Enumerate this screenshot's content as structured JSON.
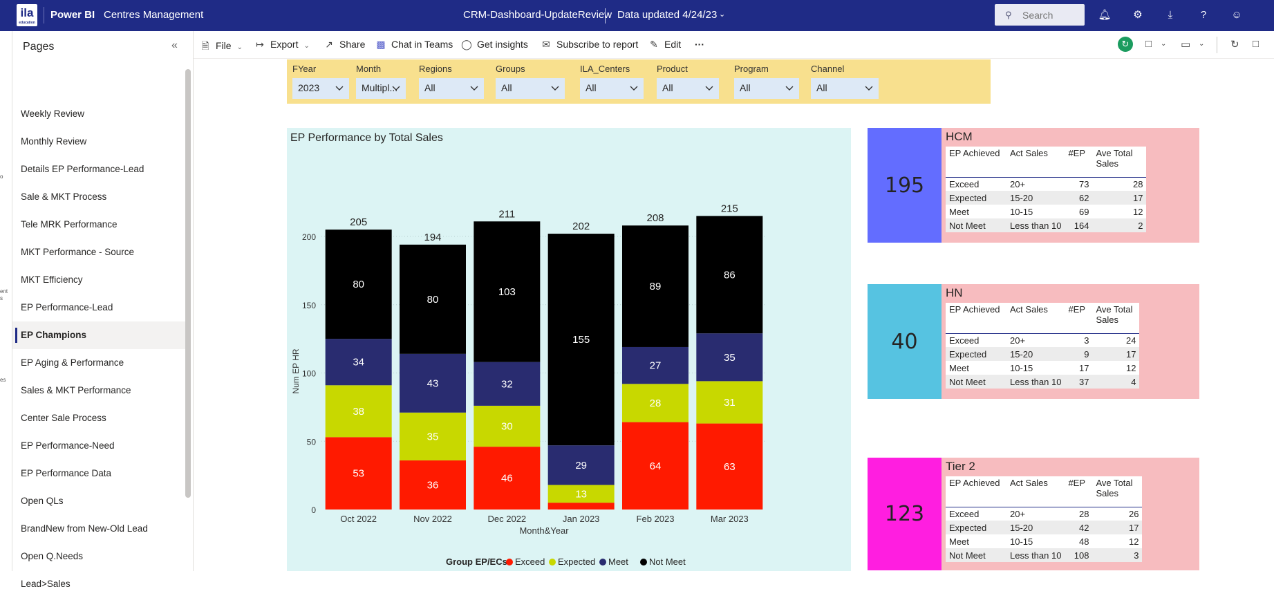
{
  "topbar": {
    "logo": "ila",
    "logo_sub": "education",
    "brand": "Power BI",
    "workspace": "Centres Management",
    "report_name": "CRM-Dashboard-UpdateReview",
    "data_updated": "Data updated 4/24/23",
    "search_placeholder": "Search"
  },
  "actions": {
    "file": "File",
    "export": "Export",
    "share": "Share",
    "chat": "Chat in Teams",
    "insights": "Get insights",
    "subscribe": "Subscribe to report",
    "edit": "Edit",
    "more": "···"
  },
  "pages": {
    "title": "Pages",
    "items": [
      {
        "label": "Weekly Review"
      },
      {
        "label": "Monthly Review"
      },
      {
        "label": "Details EP Performance-Lead"
      },
      {
        "label": "Sale & MKT Process"
      },
      {
        "label": "Tele MRK Performance"
      },
      {
        "label": "MKT Performance - Source"
      },
      {
        "label": "MKT Efficiency"
      },
      {
        "label": "EP Performance-Lead"
      },
      {
        "label": "EP Champions",
        "active": true
      },
      {
        "label": "EP Aging & Performance"
      },
      {
        "label": "Sales & MKT Performance"
      },
      {
        "label": "Center Sale Process"
      },
      {
        "label": "EP Performance-Need"
      },
      {
        "label": "EP Performance Data"
      },
      {
        "label": "Open QLs"
      },
      {
        "label": "BrandNew from New-Old Lead"
      },
      {
        "label": "Open Q.Needs"
      },
      {
        "label": "Lead>Sales"
      }
    ]
  },
  "slicers": [
    {
      "label": "FYear",
      "value": "2023"
    },
    {
      "label": "Month",
      "value": "Multipl..."
    },
    {
      "label": "Regions",
      "value": "All"
    },
    {
      "label": "Groups",
      "value": "All"
    },
    {
      "label": "ILA_Centers",
      "value": "All"
    },
    {
      "label": "Product",
      "value": "All"
    },
    {
      "label": "Program",
      "value": "All"
    },
    {
      "label": "Channel",
      "value": "All"
    }
  ],
  "chart_data": {
    "type": "bar",
    "stacked": true,
    "title": "EP Performance by Total Sales",
    "xlabel": "Month&Year",
    "ylabel": "Num EP HR",
    "ylim": [
      0,
      215
    ],
    "yticks": [
      0,
      50,
      100,
      150,
      200
    ],
    "grid": true,
    "legend_title": "Group EP/ECs",
    "legend_position": "bottom",
    "categories": [
      "Oct 2022",
      "Nov 2022",
      "Dec 2022",
      "Jan 2023",
      "Feb 2023",
      "Mar 2023"
    ],
    "series": [
      {
        "name": "Exceed",
        "color": "#ff1a00",
        "values": [
          53,
          36,
          46,
          5,
          64,
          63
        ]
      },
      {
        "name": "Expected",
        "color": "#c8d800",
        "values": [
          38,
          35,
          30,
          13,
          28,
          31
        ]
      },
      {
        "name": "Meet",
        "color": "#292c70",
        "values": [
          34,
          43,
          32,
          29,
          27,
          35
        ]
      },
      {
        "name": "Not Meet",
        "color": "#000000",
        "values": [
          80,
          80,
          103,
          155,
          89,
          86
        ]
      }
    ],
    "totals": [
      205,
      194,
      211,
      202,
      208,
      215
    ]
  },
  "cards": [
    {
      "title": "HCM",
      "number": "195",
      "color": "#636dff",
      "headers": [
        "EP Achieved",
        "Act Sales",
        "#EP",
        "Ave Total Sales"
      ],
      "rows": [
        [
          "Exceed",
          "20+",
          "73",
          "28"
        ],
        [
          "Expected",
          "15-20",
          "62",
          "17"
        ],
        [
          "Meet",
          "10-15",
          "69",
          "12"
        ],
        [
          "Not Meet",
          "Less than 10",
          "164",
          "2"
        ]
      ]
    },
    {
      "title": "HN",
      "number": "40",
      "color": "#56c3e1",
      "headers": [
        "EP Achieved",
        "Act Sales",
        "#EP",
        "Ave Total Sales"
      ],
      "rows": [
        [
          "Exceed",
          "20+",
          "3",
          "24"
        ],
        [
          "Expected",
          "15-20",
          "9",
          "17"
        ],
        [
          "Meet",
          "10-15",
          "17",
          "12"
        ],
        [
          "Not Meet",
          "Less than 10",
          "37",
          "4"
        ]
      ]
    },
    {
      "title": "Tier 2",
      "number": "123",
      "color": "#ff1ee0",
      "headers": [
        "EP Achieved",
        "Act Sales",
        "#EP",
        "Ave Total Sales"
      ],
      "rows": [
        [
          "Exceed",
          "20+",
          "28",
          "26"
        ],
        [
          "Expected",
          "15-20",
          "42",
          "17"
        ],
        [
          "Meet",
          "10-15",
          "48",
          "12"
        ],
        [
          "Not Meet",
          "Less than 10",
          "108",
          "3"
        ]
      ]
    }
  ]
}
